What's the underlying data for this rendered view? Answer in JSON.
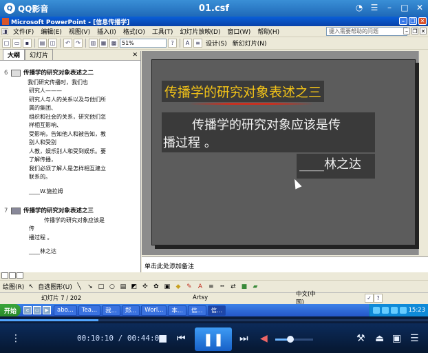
{
  "player": {
    "app_name": "QQ影音",
    "file_name": "01.csf",
    "time_current": "00:10:10",
    "time_total": "00:44:04",
    "time_sep": " / ",
    "progress_fraction": 0.23,
    "volume_fraction": 0.4
  },
  "ppt": {
    "title": "Microsoft PowerPoint - [信息传播学]",
    "menu": [
      "文件(F)",
      "编辑(E)",
      "视图(V)",
      "插入(I)",
      "格式(O)",
      "工具(T)",
      "幻灯片放映(D)",
      "窗口(W)",
      "帮助(H)"
    ],
    "help_placeholder": "键入需要帮助的问题",
    "zoom": "51%",
    "design_label": "设计(S)",
    "new_slide_label": "新幻灯片(N)",
    "tabs": {
      "outline": "大纲",
      "slides": "幻灯片"
    },
    "outline": {
      "slide6": {
        "num": "6",
        "title": "传播学的研究对象表述之二",
        "lines": [
          "我们研究传播时，我们也",
          "研究人———",
          "研究人与人的关系以及与他们所",
          "属的集团、",
          "组织和社会的关系，研究他们怎",
          "样相互影响、",
          "受影响，告知他人和被告知，教",
          "别人和受别",
          "人教，娱乐别人和受到娱乐。要",
          "了解传播，",
          "我们必须了解人是怎样相互建立",
          "联系的。",
          "____W.施拉姆"
        ]
      },
      "slide7": {
        "num": "7",
        "title": "传播学的研究对象表述之三",
        "lines": [
          "传播学的研究对象应该是",
          "传",
          "播过程 。",
          "____林之达"
        ]
      }
    },
    "slide": {
      "title": "传播学的研究对象表述之三",
      "body_line1": "传播学的研究对象应该是传",
      "body_line2": "播过程 。",
      "author": "____林之达"
    },
    "notes_placeholder": "单击此处添加备注",
    "draw_label": "绘图(R)",
    "autoshape_label": "自选图形(U)",
    "status": {
      "slide_pos": "幻灯片 7 / 202",
      "design": "Artsy",
      "lang": "中文(中国)"
    }
  },
  "taskbar": {
    "start": "开始",
    "tasks": [
      "abo...",
      "Tea...",
      "我...",
      "郑...",
      "Worl...",
      "本...",
      "信...",
      "信..."
    ],
    "clock": "15:23"
  }
}
